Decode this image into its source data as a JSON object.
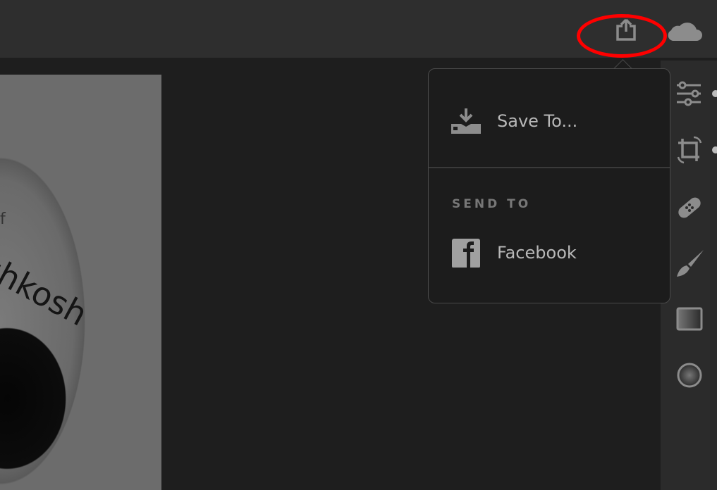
{
  "topbar": {
    "share_icon": "share-icon",
    "cloud_icon": "cloud-icon",
    "highlight_color": "#ff0000"
  },
  "photo": {
    "text_small": "f",
    "text_large": "shkosh"
  },
  "popover": {
    "save_label": "Save To...",
    "save_icon": "download-tray-icon",
    "section_label": "SEND TO",
    "facebook_label": "Facebook",
    "facebook_icon": "facebook-icon"
  },
  "tools": [
    "sliders-icon",
    "crop-rotate-icon",
    "bandage-icon",
    "brush-icon",
    "linear-gradient-icon",
    "radial-gradient-icon"
  ],
  "colors": {
    "background": "#1e1e1e",
    "topbar": "#2e2e2e",
    "popover": "#1c1c1c",
    "icon": "#8c8c8c",
    "text": "#b8b8b8"
  }
}
